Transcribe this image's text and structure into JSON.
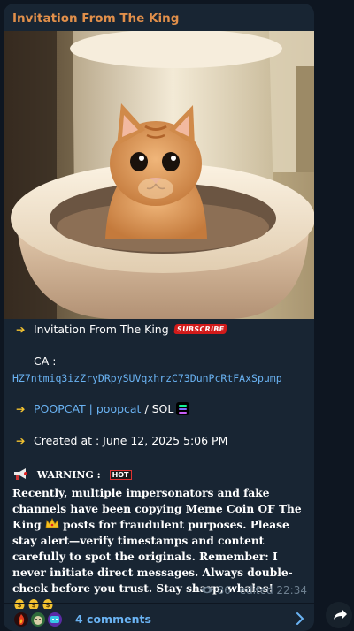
{
  "post": {
    "channel_title": "Invitation From The King",
    "line1_text": "Invitation From The King",
    "subscribe_badge": "SUBSCRIBE",
    "ca_label": "CA :",
    "ca_value": "HZ7ntmiq3izZryDRpySUVqxhrzC73DunPcRtFAxSpump",
    "token_link": "POOPCAT | poopcat",
    "token_chain": " / SOL",
    "created_text": "Created at : June 12, 2025 5:06 PM",
    "warning_label": "WARNING :",
    "hot_badge": "HOT",
    "body_part1": "Recently, multiple impersonators and fake channels have been copying Meme Coin OF The King ",
    "body_part2": " posts for fraudulent purposes. Please stay alert—verify timestamps and content carefully to spot the originals. Remember: I never initiate direct messages. Always double-check before you trust. Stay sharp, whales! ",
    "views": "86",
    "edited_time": "edited 22:34"
  },
  "comments": {
    "label": "4 comments"
  },
  "colors": {
    "background": "#0e1621",
    "bubble": "#182533",
    "title": "#e18f4a",
    "link": "#6ab3f3",
    "meta": "#6d7f8f",
    "arrow": "#f2c230"
  },
  "icons": [
    "arrow-right-icon",
    "subscribe-badge-icon",
    "solana-icon",
    "megaphone-icon",
    "hot-badge-icon",
    "crown-icon",
    "money-bag-icon",
    "eye-icon",
    "chevron-right-icon",
    "share-icon"
  ]
}
